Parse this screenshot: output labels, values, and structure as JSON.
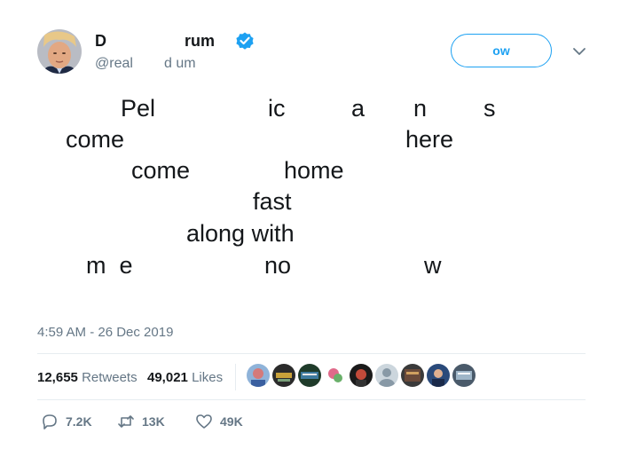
{
  "author": {
    "name_parts": [
      "D",
      "rum"
    ],
    "handle_parts": [
      "@real",
      "d  um"
    ]
  },
  "follow_label": "ow",
  "tweet_fragments": [
    {
      "text": "Pel"
    },
    {
      "text": "ic"
    },
    {
      "text": "a"
    },
    {
      "text": "n"
    },
    {
      "text": "s"
    },
    {
      "text": "come"
    },
    {
      "text": "here"
    },
    {
      "text": "come"
    },
    {
      "text": "home"
    },
    {
      "text": "fast"
    },
    {
      "text": "along with"
    },
    {
      "text": "m  e"
    },
    {
      "text": "no"
    },
    {
      "text": "w"
    }
  ],
  "timestamp": "4:59 AM - 26 Dec 2019",
  "stats": {
    "retweets_count": "12,655",
    "retweets_label": "Retweets",
    "likes_count": "49,021",
    "likes_label": "Likes"
  },
  "actions": {
    "reply_count": "7.2K",
    "retweet_count": "13K",
    "like_count": "49K"
  },
  "colors": {
    "accent": "#1da1f2",
    "secondary_text": "#657786",
    "primary_text": "#14171a"
  }
}
